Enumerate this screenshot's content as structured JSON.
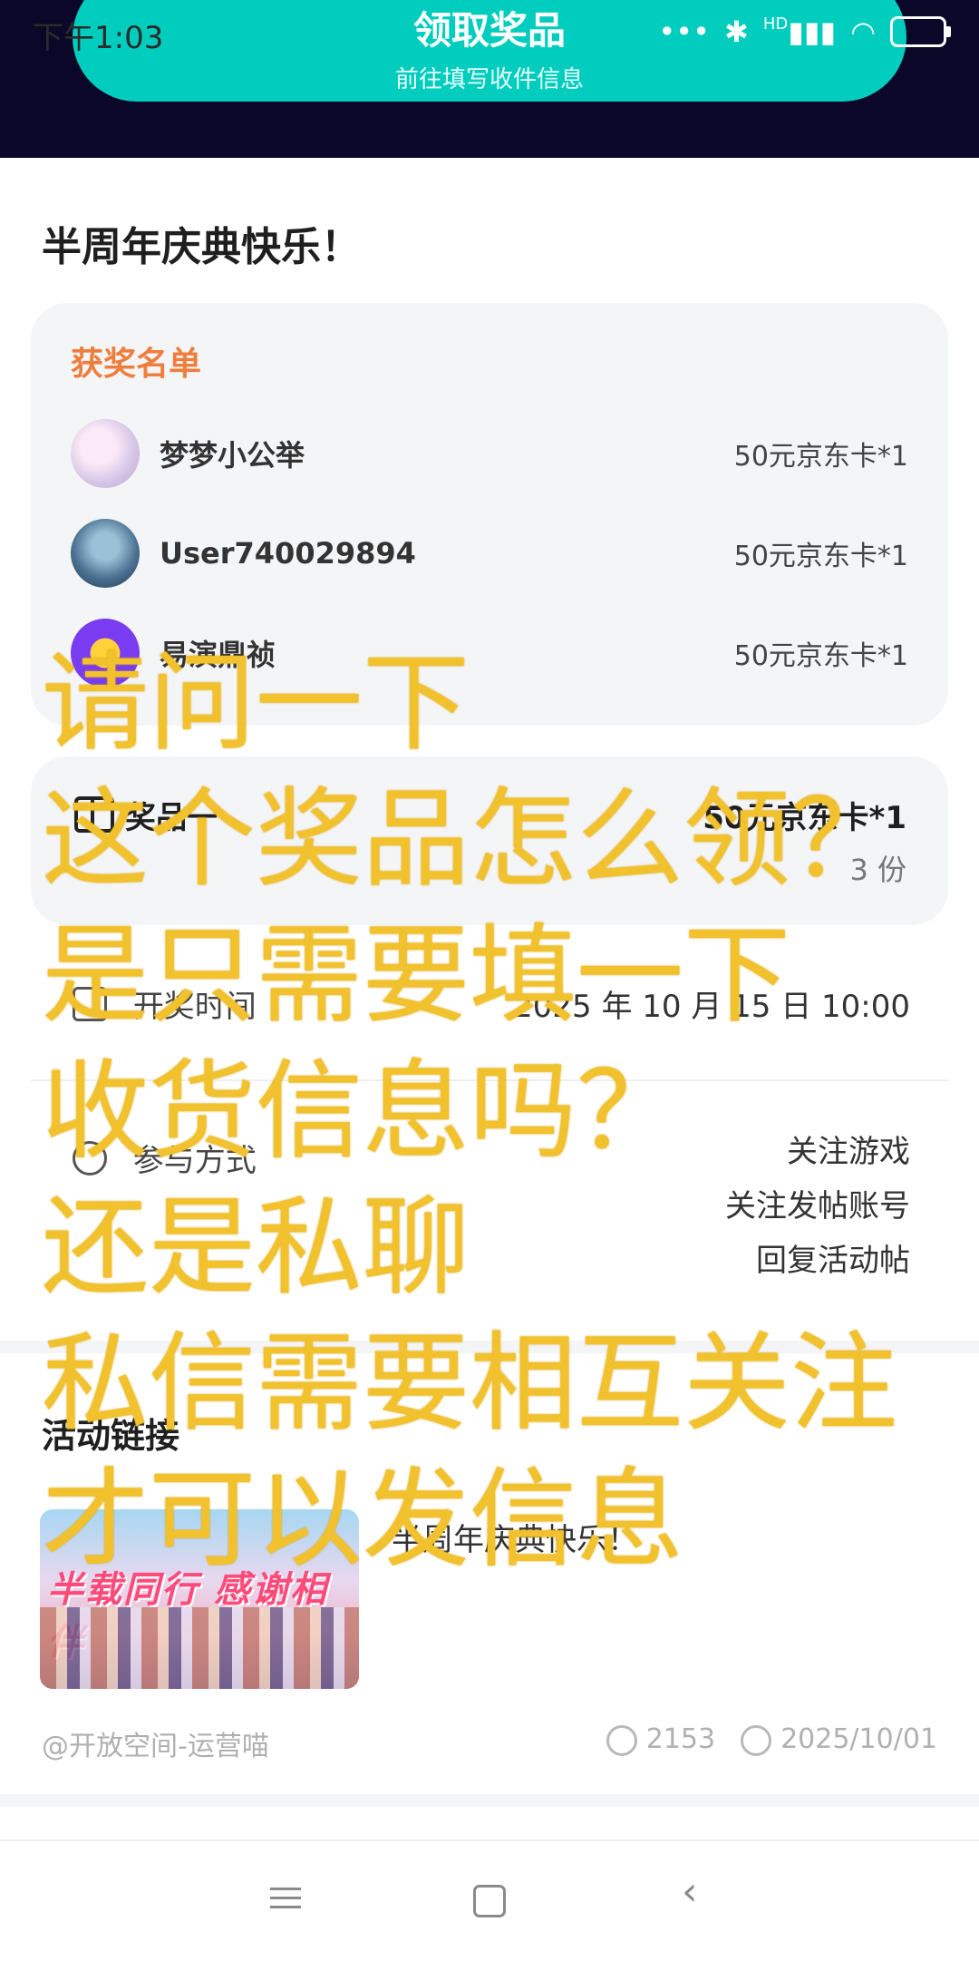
{
  "status_bar": {
    "time": "下午1:03",
    "network_label": "HD"
  },
  "claim_button": {
    "title": "领取奖品",
    "subtitle": "前往填写收件信息"
  },
  "page_title": "半周年庆典快乐！",
  "winners": {
    "label": "获奖名单",
    "items": [
      {
        "name": "梦梦小公举",
        "prize": "50元京东卡*1"
      },
      {
        "name": "User740029894",
        "prize": "50元京东卡*1"
      },
      {
        "name": "易演鼎祯",
        "prize": "50元京东卡*1"
      }
    ]
  },
  "prize": {
    "label": "奖品一",
    "value": "50元京东卡*1",
    "quantity": "3 份"
  },
  "draw_time": {
    "label": "开奖时间",
    "value": "2025 年 10 月 15 日 10:00"
  },
  "participation": {
    "label": "参与方式",
    "values": [
      "关注游戏",
      "关注发帖账号",
      "回复活动帖"
    ]
  },
  "activity_link": {
    "title": "活动链接",
    "thumb_text": "半载同行 感谢相伴",
    "text": "半周年庆典快乐！"
  },
  "footer_meta": {
    "author": "@开放空间-运营喵",
    "views": "2153",
    "date": "2025/10/01"
  },
  "overlay_lines": [
    "请问一下",
    "这个奖品怎么领？",
    "是只需要填一下",
    "收货信息吗？",
    "还是私聊",
    "私信需要相互关注",
    "才可以发信息"
  ]
}
